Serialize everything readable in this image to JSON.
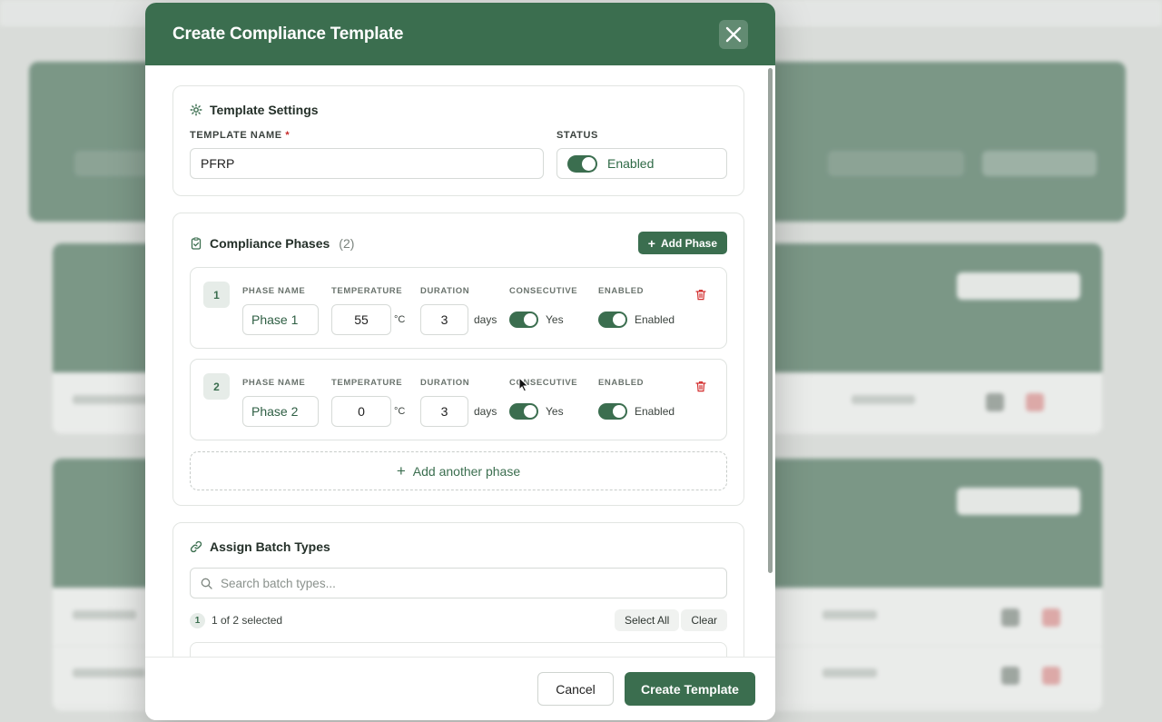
{
  "modal": {
    "title": "Create Compliance Template",
    "close_icon": "close-icon"
  },
  "template_settings": {
    "heading": "Template Settings",
    "name_label": "TEMPLATE NAME",
    "required_mark": "*",
    "name_value": "PFRP",
    "status_label": "STATUS",
    "status_value": "Enabled",
    "status_on": true
  },
  "phases": {
    "heading": "Compliance Phases",
    "count": "(2)",
    "add_button": "Add Phase",
    "labels": {
      "name": "PHASE NAME",
      "temperature": "TEMPERATURE",
      "duration": "DURATION",
      "consecutive": "CONSECUTIVE",
      "enabled": "ENABLED"
    },
    "items": [
      {
        "number": "1",
        "name": "Phase 1",
        "temperature": "55",
        "temp_unit": "°C",
        "duration": "3",
        "duration_unit": "days",
        "consecutive": "Yes",
        "enabled": "Enabled"
      },
      {
        "number": "2",
        "name": "Phase 2",
        "temperature": "0",
        "temp_unit": "°C",
        "duration": "3",
        "duration_unit": "days",
        "consecutive": "Yes",
        "enabled": "Enabled"
      }
    ],
    "add_another": "Add another phase"
  },
  "batch_types": {
    "heading": "Assign Batch Types",
    "search_placeholder": "Search batch types...",
    "selected_count": "1",
    "selected_text": "1 of 2 selected",
    "select_all": "Select All",
    "clear": "Clear"
  },
  "footer": {
    "cancel": "Cancel",
    "create": "Create Template"
  },
  "colors": {
    "brand_green": "#3b6e4f",
    "danger_red": "#d32f2f"
  }
}
